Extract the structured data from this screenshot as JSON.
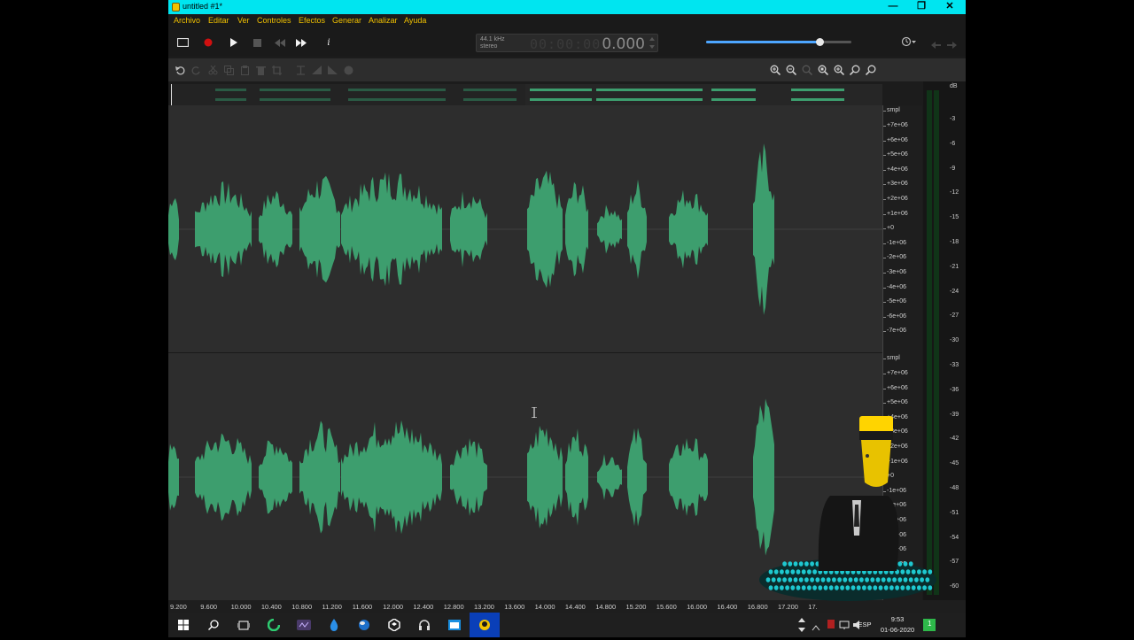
{
  "window": {
    "title": "untitled #1*",
    "minimize": "—",
    "maximize": "❐",
    "close": "✕"
  },
  "menu": [
    "Archivo",
    "Editar",
    "Ver",
    "Controles",
    "Efectos",
    "Generar",
    "Analizar",
    "Ayuda"
  ],
  "transport": {
    "sample_rate": "44.1 kHz",
    "channels": "stereo",
    "position": "0.000",
    "ghost_digits": "00:00:00",
    "info_label": "i",
    "volume_level": 0.78
  },
  "toolbar_icons": [
    "undo-icon",
    "redo-icon",
    "cut-icon",
    "copy-icon",
    "paste-icon",
    "delete-icon",
    "crop-icon",
    "trim-icon",
    "fade-in-icon",
    "fade-out-icon",
    "normalize-icon",
    "zoom-in-icon",
    "zoom-out-icon",
    "zoom-selection-icon",
    "zoom-fit-icon",
    "zoom-full-icon",
    "zoom-marker-in-icon",
    "zoom-marker-out-icon"
  ],
  "amplitude_ruler": {
    "unit": "smpl",
    "ticks": [
      "+7e+06",
      "+6e+06",
      "+5e+06",
      "+4e+06",
      "+3e+06",
      "+2e+06",
      "+1e+06",
      "+0",
      "-1e+06",
      "-2e+06",
      "-3e+06",
      "-4e+06",
      "-5e+06",
      "-6e+06",
      "-7e+06"
    ]
  },
  "level_meter": {
    "unit": "dB",
    "ticks": [
      "-3",
      "-6",
      "-9",
      "-12",
      "-15",
      "-18",
      "-21",
      "-24",
      "-27",
      "-30",
      "-33",
      "-36",
      "-39",
      "-42",
      "-45",
      "-48",
      "-51",
      "-54",
      "-57",
      "-60"
    ]
  },
  "time_ruler": [
    "9.200",
    "9.600",
    "10.000",
    "10.400",
    "10.800",
    "11.200",
    "11.600",
    "12.000",
    "12.400",
    "12.800",
    "13.200",
    "13.600",
    "14.000",
    "14.400",
    "14.800",
    "15.200",
    "15.600",
    "16.000",
    "16.400",
    "16.800",
    "17.200",
    "17."
  ],
  "colors": {
    "waveform": "#3d9e6e",
    "title_bar": "#00e5f0",
    "menu_text": "#f0c000",
    "record": "#d01010"
  },
  "taskbar": {
    "apps": [
      "start-icon",
      "search-icon",
      "task-view-icon",
      "browser-icon",
      "media-icon",
      "drop-icon",
      "globe-icon",
      "unity-icon",
      "headphones-icon",
      "window-icon",
      "ocenaudio-icon"
    ],
    "language": "ESP",
    "time": "9:53",
    "date": "01-06-2020",
    "notification_count": "1"
  }
}
